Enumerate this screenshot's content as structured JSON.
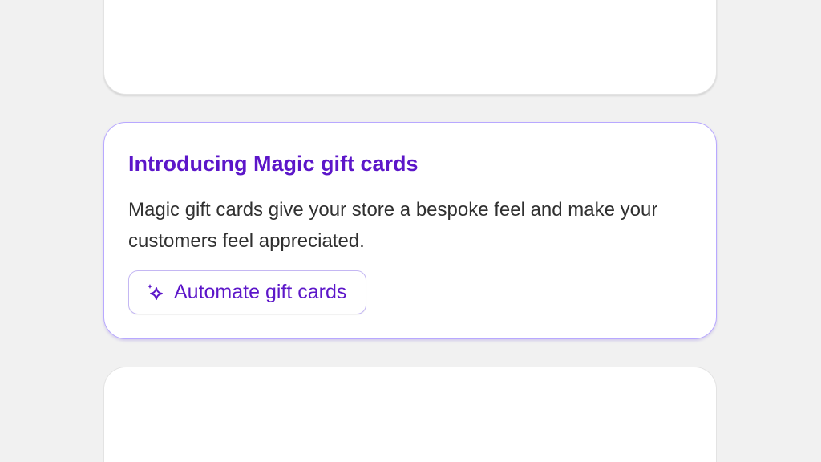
{
  "promo_card": {
    "title": "Introducing Magic gift cards",
    "description": "Magic gift cards give your store a bespoke feel and make your customers feel appreciated.",
    "action_label": "Automate gift cards",
    "action_icon": "magic-sparkle-icon"
  },
  "colors": {
    "accent": "#5c16c9",
    "card_border_accent": "#b8a8ff",
    "background": "#f1f1f1",
    "body_text": "#303030"
  }
}
